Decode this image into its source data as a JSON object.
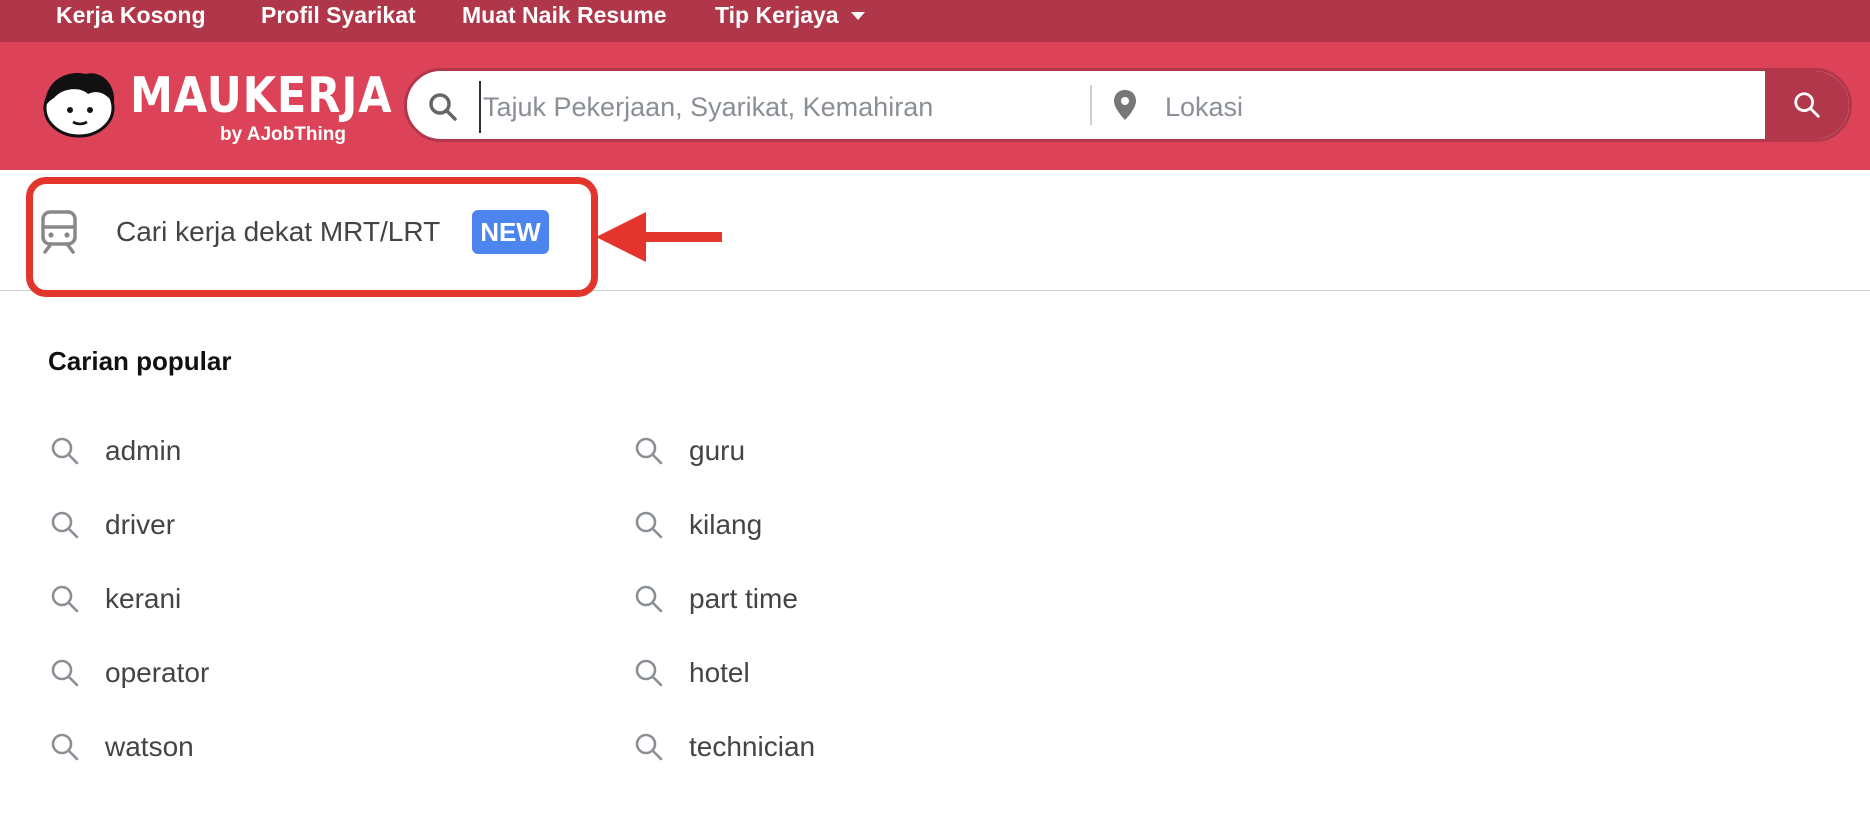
{
  "topnav": {
    "items": [
      "Kerja Kosong",
      "Profil Syarikat",
      "Muat Naik Resume",
      "Tip Kerjaya"
    ]
  },
  "logo": {
    "wordmark": "MAUKERJA",
    "byline": "by AJobThing"
  },
  "search": {
    "keyword_placeholder": "Tajuk Pekerjaan, Syarikat, Kemahiran",
    "keyword_value": "",
    "location_placeholder": "Lokasi",
    "location_value": ""
  },
  "mrt": {
    "label": "Cari kerja dekat MRT/LRT",
    "badge": "NEW"
  },
  "popular": {
    "title": "Carian popular",
    "left": [
      "admin",
      "driver",
      "kerani",
      "operator",
      "watson"
    ],
    "right": [
      "guru",
      "kilang",
      "part time",
      "hotel",
      "technician"
    ]
  },
  "colors": {
    "nav_bg": "#b0364a",
    "header_bg": "#dc4358",
    "search_button": "#b3374b",
    "badge_bg": "#4c84f0",
    "annotation": "#e4352c"
  },
  "icons": {
    "search": "search-icon",
    "location": "map-pin-icon",
    "train": "train-icon",
    "caret": "chevron-down-icon",
    "annotation_arrow": "arrow-left-icon"
  }
}
